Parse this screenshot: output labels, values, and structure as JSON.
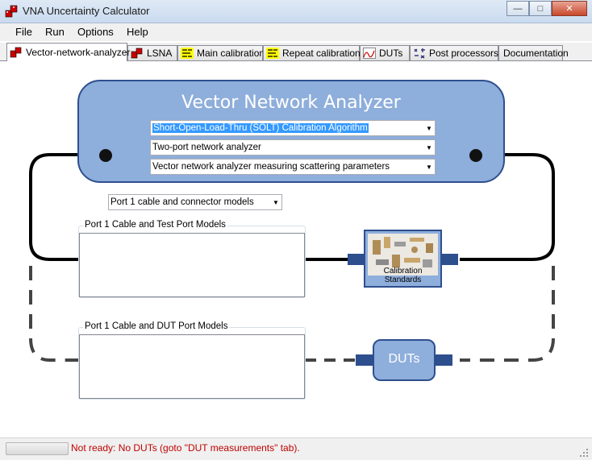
{
  "window": {
    "title": "VNA Uncertainty Calculator"
  },
  "menu": [
    "File",
    "Run",
    "Options",
    "Help"
  ],
  "tabs": [
    {
      "label": "Vector-network-analyzer",
      "icon": "vna-icon",
      "active": true
    },
    {
      "label": "LSNA",
      "icon": "vna-icon",
      "active": false
    },
    {
      "label": "Main calibration",
      "icon": "calibration-icon",
      "active": false
    },
    {
      "label": "Repeat calibration",
      "icon": "calibration-icon",
      "active": false
    },
    {
      "label": "DUTs",
      "icon": "dut-chart-icon",
      "active": false
    },
    {
      "label": "Post processors",
      "icon": "post-processor-icon",
      "active": false
    },
    {
      "label": "Documentation",
      "icon": "",
      "active": false
    }
  ],
  "vna": {
    "title": "Vector Network Analyzer",
    "calibration_algorithm": "Short-Open-Load-Thru (SOLT) Calibration Algorithm",
    "analyzer_type": "Two-port network analyzer",
    "measurement_mode": "Vector network analyzer measuring scattering parameters"
  },
  "port1": {
    "model_select": "Port 1 cable and connector models",
    "test_port_group": "Port 1 Cable and Test Port Models",
    "dut_port_group": "Port 1 Cable and DUT Port Models"
  },
  "blocks": {
    "calibration_standards": "Calibration Standards",
    "duts": "DUTs"
  },
  "status": {
    "message": "Not ready: No DUTs (goto \"DUT measurements\" tab).",
    "color": "#c00000"
  },
  "colors": {
    "block_fill": "#8eaedb",
    "block_border": "#2e4f8e"
  }
}
